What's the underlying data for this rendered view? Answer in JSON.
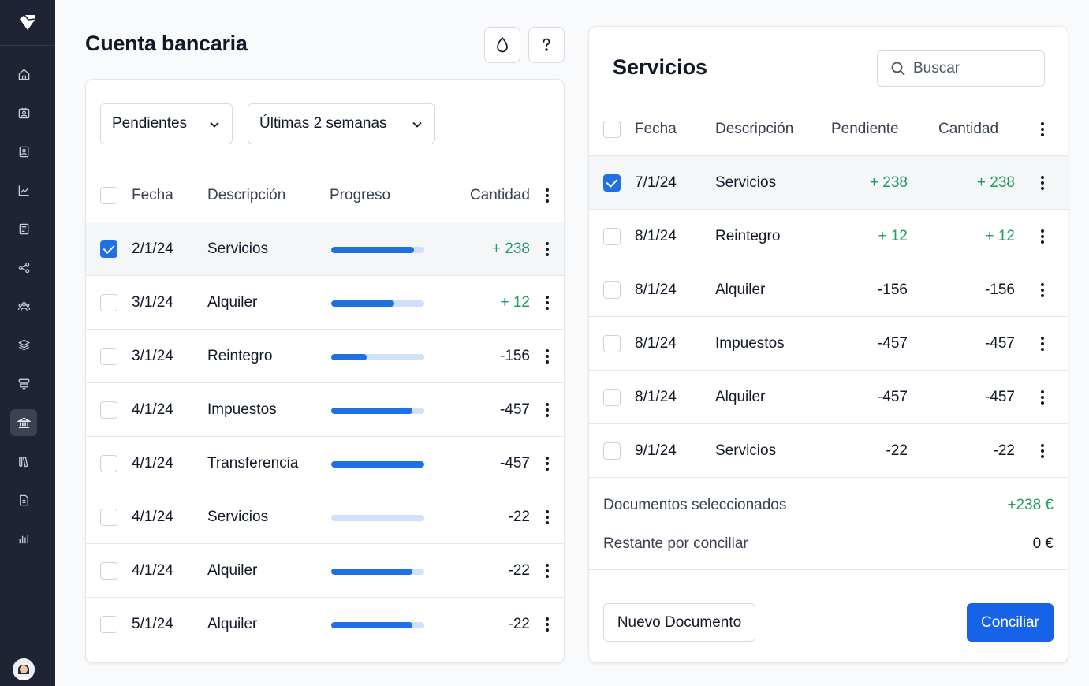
{
  "sidebar": {
    "items": [
      {
        "icon": "home-icon"
      },
      {
        "icon": "contacts-icon"
      },
      {
        "icon": "address-book-icon"
      },
      {
        "icon": "chart-line-icon"
      },
      {
        "icon": "document-icon"
      },
      {
        "icon": "share-icon"
      },
      {
        "icon": "users-icon"
      },
      {
        "icon": "layers-icon"
      },
      {
        "icon": "stack-icon"
      },
      {
        "icon": "bank-icon",
        "active": true
      },
      {
        "icon": "library-icon"
      },
      {
        "icon": "invoice-icon"
      },
      {
        "icon": "bar-chart-icon"
      }
    ]
  },
  "header": {
    "title": "Cuenta bancaria"
  },
  "left": {
    "filter_status": "Pendientes",
    "filter_period": "Últimas 2 semanas",
    "columns": {
      "date": "Fecha",
      "description": "Descripción",
      "progress": "Progreso",
      "amount": "Cantidad"
    },
    "rows": [
      {
        "date": "2/1/24",
        "description": "Servicios",
        "progress": 0.89,
        "amount": "+ 238",
        "positive": true,
        "checked": true
      },
      {
        "date": "3/1/24",
        "description": "Alquiler",
        "progress": 0.68,
        "amount": "+ 12",
        "positive": true,
        "checked": false
      },
      {
        "date": "3/1/24",
        "description": "Reintegro",
        "progress": 0.38,
        "amount": "-156",
        "positive": false,
        "checked": false
      },
      {
        "date": "4/1/24",
        "description": "Impuestos",
        "progress": 0.87,
        "amount": "-457",
        "positive": false,
        "checked": false
      },
      {
        "date": "4/1/24",
        "description": "Transferencia",
        "progress": 1.0,
        "amount": "-457",
        "positive": false,
        "checked": false
      },
      {
        "date": "4/1/24",
        "description": "Servicios",
        "progress": 0.0,
        "amount": "-22",
        "positive": false,
        "checked": false
      },
      {
        "date": "4/1/24",
        "description": "Alquiler",
        "progress": 0.87,
        "amount": "-22",
        "positive": false,
        "checked": false
      },
      {
        "date": "5/1/24",
        "description": "Alquiler",
        "progress": 0.87,
        "amount": "-22",
        "positive": false,
        "checked": false
      }
    ]
  },
  "right": {
    "title": "Servicios",
    "search_placeholder": "Buscar",
    "columns": {
      "date": "Fecha",
      "description": "Descripción",
      "pending": "Pendiente",
      "amount": "Cantidad"
    },
    "rows": [
      {
        "date": "7/1/24",
        "description": "Servicios",
        "pending": "+ 238",
        "amount": "+ 238",
        "positive": true,
        "checked": true
      },
      {
        "date": "8/1/24",
        "description": "Reintegro",
        "pending": "+ 12",
        "amount": "+ 12",
        "positive": true,
        "checked": false
      },
      {
        "date": "8/1/24",
        "description": "Alquiler",
        "pending": "-156",
        "amount": "-156",
        "positive": false,
        "checked": false
      },
      {
        "date": "8/1/24",
        "description": "Impuestos",
        "pending": "-457",
        "amount": "-457",
        "positive": false,
        "checked": false
      },
      {
        "date": "8/1/24",
        "description": "Alquiler",
        "pending": "-457",
        "amount": "-457",
        "positive": false,
        "checked": false
      },
      {
        "date": "9/1/24",
        "description": "Servicios",
        "pending": "-22",
        "amount": "-22",
        "positive": false,
        "checked": false
      }
    ],
    "summary": {
      "selected_label": "Documentos seleccionados",
      "selected_value": "+238 €",
      "remaining_label": "Restante por conciliar",
      "remaining_value": "0 €"
    },
    "new_document_label": "Nuevo Documento",
    "reconcile_label": "Conciliar"
  },
  "colors": {
    "accent": "#1763e8",
    "positive": "#1e9b5e",
    "sidebar": "#1e2433"
  }
}
